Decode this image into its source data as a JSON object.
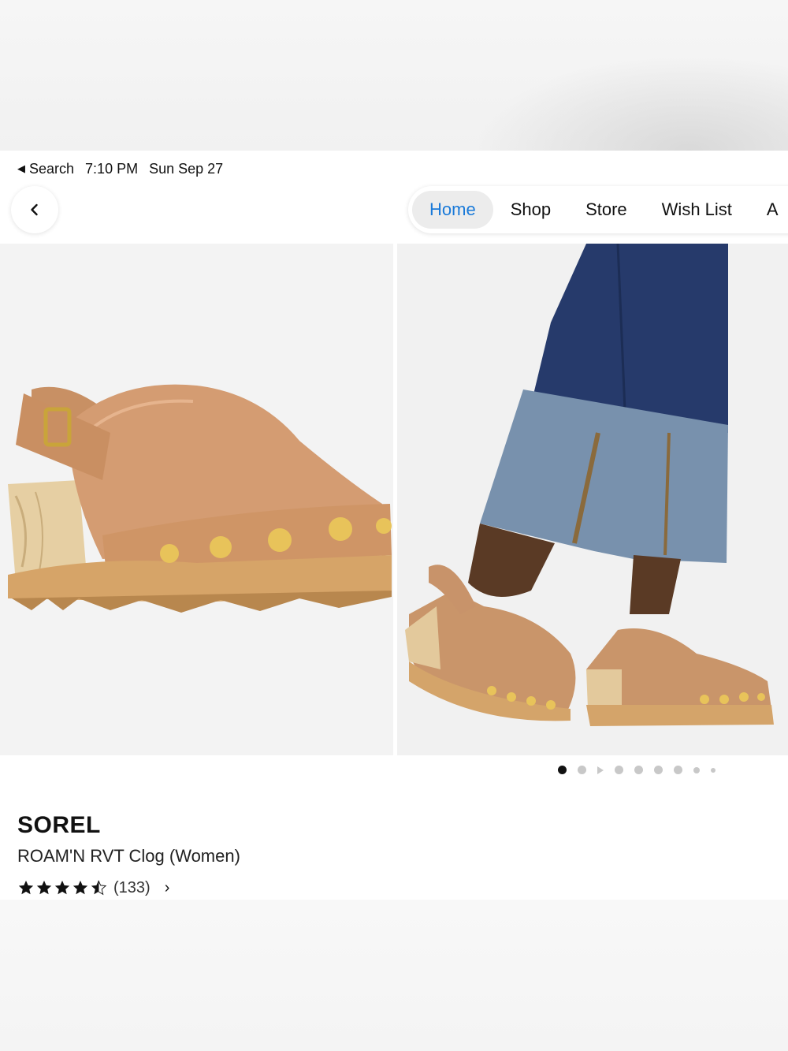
{
  "status_bar": {
    "back_app": "Search",
    "time": "7:10 PM",
    "date": "Sun Sep 27"
  },
  "nav": {
    "back_icon": "chevron-left-icon",
    "tabs": [
      {
        "label": "Home",
        "active": true
      },
      {
        "label": "Shop",
        "active": false
      },
      {
        "label": "Store",
        "active": false
      },
      {
        "label": "Wish List",
        "active": false
      },
      {
        "label": "A",
        "active": false
      }
    ],
    "accent_color": "#1a7ad9"
  },
  "gallery": {
    "images": [
      {
        "name": "product-photo-clog-side-view"
      },
      {
        "name": "product-photo-model-wearing-clogs"
      }
    ],
    "dots": {
      "total": 9,
      "active_index": 0
    }
  },
  "product": {
    "brand": "SOREL",
    "name": "ROAM'N RVT Clog (Women)",
    "rating": 4.5,
    "rating_max": 5,
    "review_count": "(133)"
  }
}
